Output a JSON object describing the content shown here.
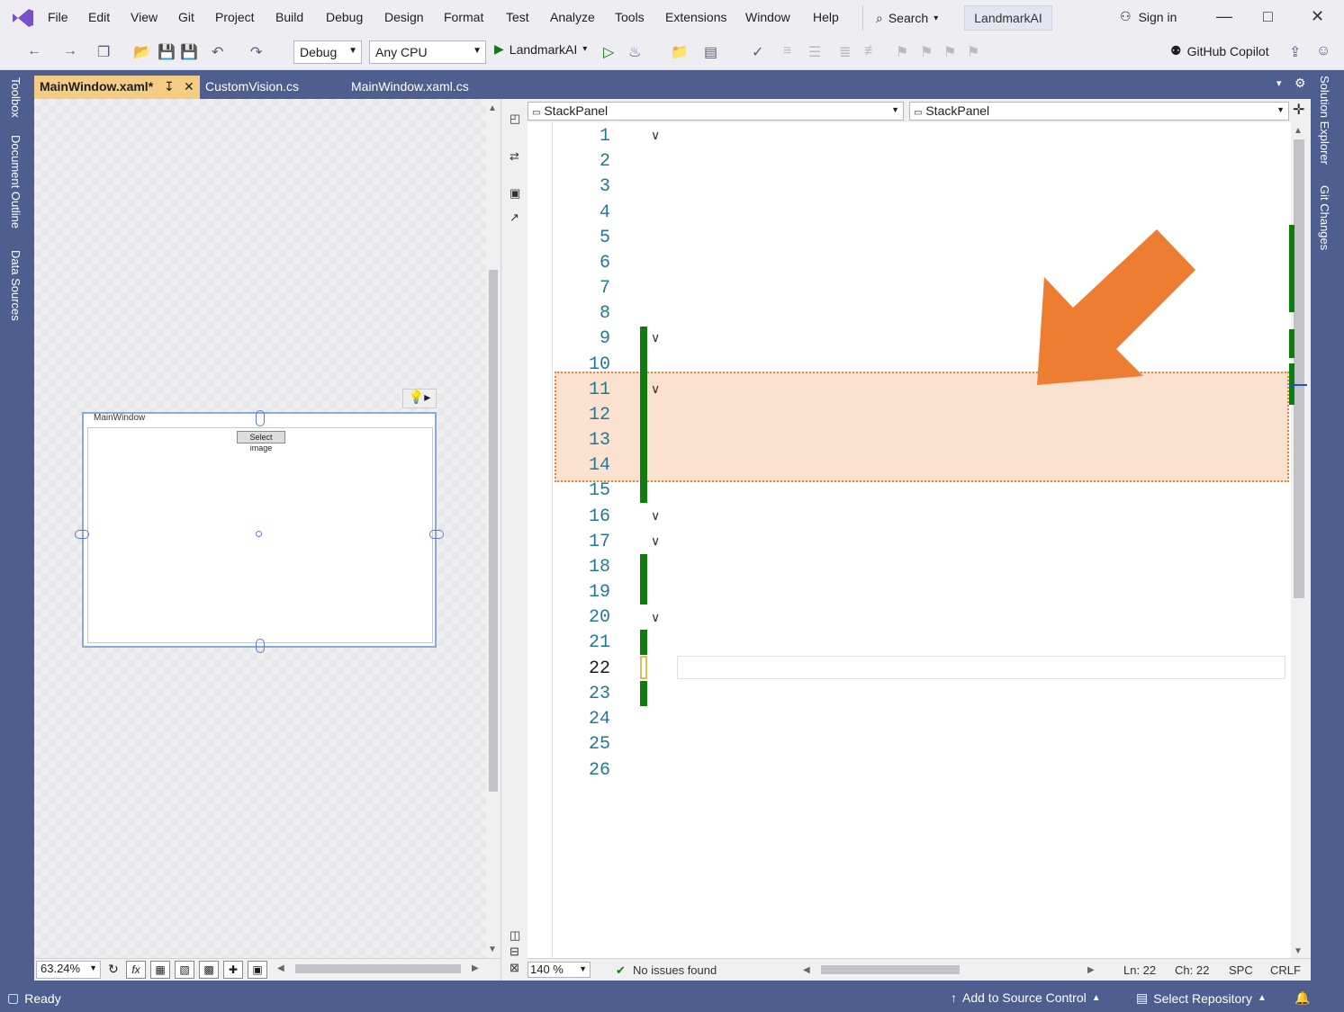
{
  "menu": {
    "items": [
      "File",
      "Edit",
      "View",
      "Git",
      "Project",
      "Build",
      "Debug",
      "Design",
      "Format",
      "Test",
      "Analyze",
      "Tools",
      "Extensions",
      "Window",
      "Help"
    ],
    "search_label": "Search",
    "solution_name": "LandmarkAI",
    "sign_in": "Sign in"
  },
  "toolbar": {
    "config": "Debug",
    "platform": "Any CPU",
    "run_target": "LandmarkAI",
    "copilot": "GitHub Copilot"
  },
  "left_strip": {
    "tabs": [
      "Toolbox",
      "Document Outline",
      "Data Sources"
    ]
  },
  "right_strip": {
    "tabs": [
      "Solution Explorer",
      "Git Changes"
    ]
  },
  "tabs": {
    "main": "MainWindow.xaml*",
    "customvision": "CustomVision.cs",
    "mainwindow_cs": "MainWindow.xaml.cs"
  },
  "designer": {
    "window_title": "MainWindow",
    "button_label": "Select image",
    "zoom": "63.24%"
  },
  "navbar": {
    "left": "StackPanel",
    "right": "StackPanel"
  },
  "code": {
    "line_numbers": [
      "1",
      "2",
      "3",
      "4",
      "5",
      "6",
      "7",
      "8",
      "9",
      "10",
      "11",
      "12",
      "13",
      "14",
      "15",
      "16",
      "17",
      "18",
      "19",
      "20",
      "21",
      "22",
      "23",
      "24",
      "25",
      "26"
    ],
    "current_line": "22"
  },
  "editor_status": {
    "zoom": "140 %",
    "issues": "No issues found",
    "ln": "Ln: 22",
    "ch": "Ch: 22",
    "spc": "SPC",
    "crlf": "CRLF"
  },
  "statusbar": {
    "ready": "Ready",
    "add_source": "Add to Source Control",
    "select_repo": "Select Repository"
  },
  "colors": {
    "accent": "#4d5e8f",
    "highlight_border": "#e8833a",
    "arrow": "#ed7d31",
    "change_bar": "#107c10"
  }
}
